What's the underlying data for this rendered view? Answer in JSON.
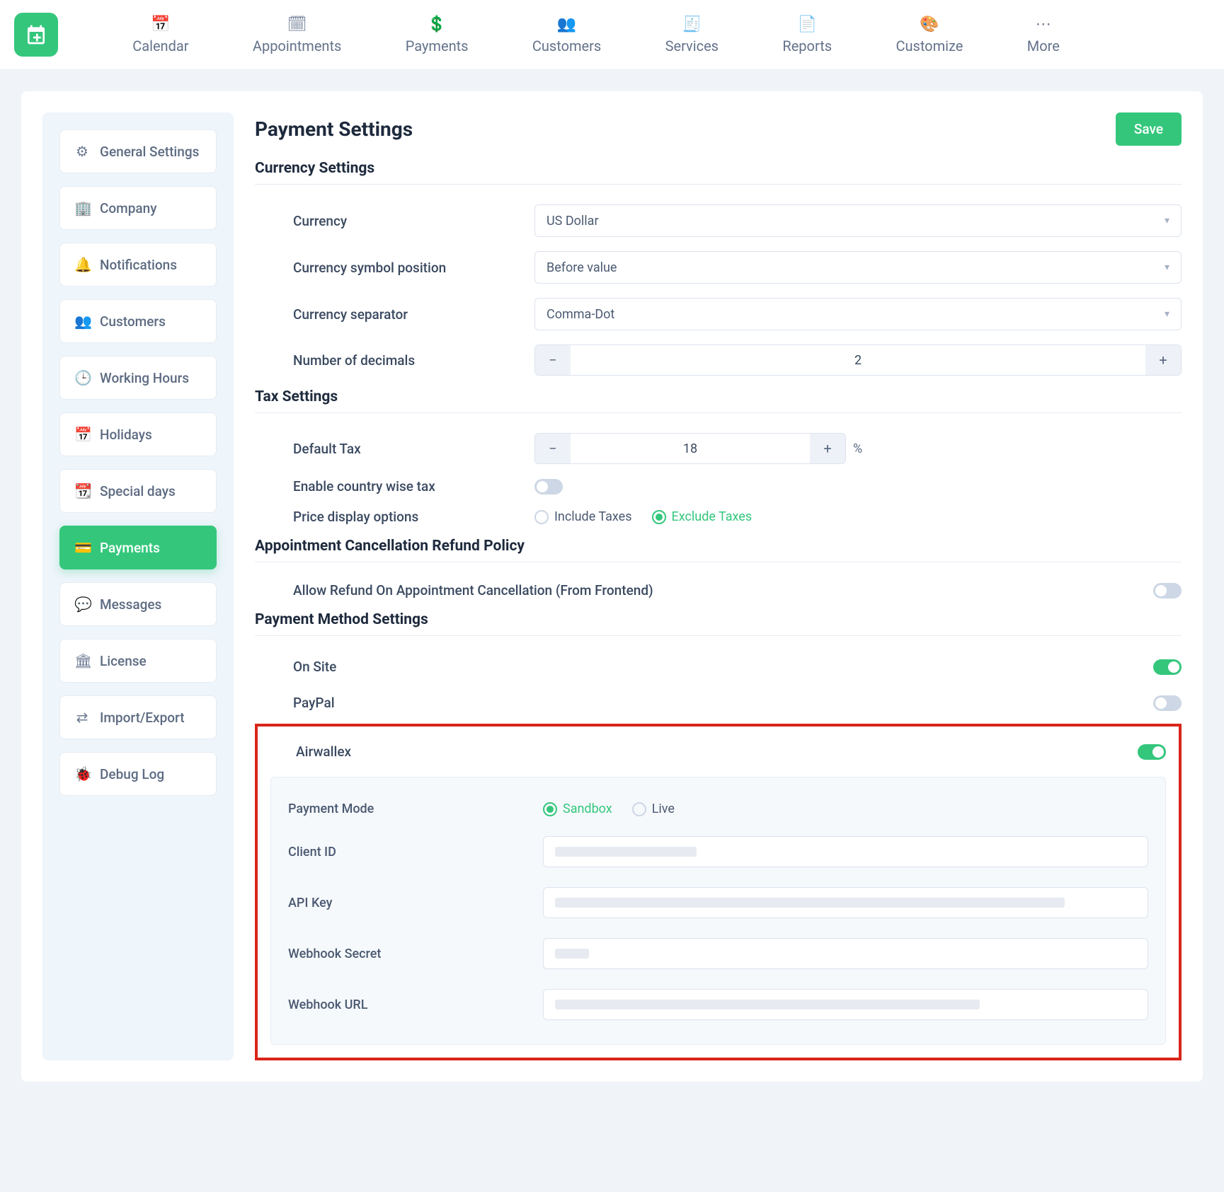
{
  "nav": {
    "items": [
      {
        "label": "Calendar"
      },
      {
        "label": "Appointments"
      },
      {
        "label": "Payments"
      },
      {
        "label": "Customers"
      },
      {
        "label": "Services"
      },
      {
        "label": "Reports"
      },
      {
        "label": "Customize"
      },
      {
        "label": "More"
      }
    ]
  },
  "sidebar": {
    "items": [
      {
        "label": "General Settings"
      },
      {
        "label": "Company"
      },
      {
        "label": "Notifications"
      },
      {
        "label": "Customers"
      },
      {
        "label": "Working Hours"
      },
      {
        "label": "Holidays"
      },
      {
        "label": "Special days"
      },
      {
        "label": "Payments"
      },
      {
        "label": "Messages"
      },
      {
        "label": "License"
      },
      {
        "label": "Import/Export"
      },
      {
        "label": "Debug Log"
      }
    ]
  },
  "page": {
    "title": "Payment Settings",
    "save": "Save"
  },
  "sections": {
    "currency": {
      "title": "Currency Settings",
      "currency_label": "Currency",
      "currency_value": "US Dollar",
      "position_label": "Currency symbol position",
      "position_value": "Before value",
      "separator_label": "Currency separator",
      "separator_value": "Comma-Dot",
      "decimals_label": "Number of decimals",
      "decimals_value": "2"
    },
    "tax": {
      "title": "Tax Settings",
      "default_label": "Default Tax",
      "default_value": "18",
      "suffix": "%",
      "countrywise_label": "Enable country wise tax",
      "display_label": "Price display options",
      "include": "Include Taxes",
      "exclude": "Exclude Taxes"
    },
    "refund": {
      "title": "Appointment Cancellation Refund Policy",
      "allow_label": "Allow Refund On Appointment Cancellation (From Frontend)"
    },
    "methods": {
      "title": "Payment Method Settings",
      "onsite": "On Site",
      "paypal": "PayPal",
      "airwallex": {
        "label": "Airwallex",
        "mode_label": "Payment Mode",
        "sandbox": "Sandbox",
        "live": "Live",
        "client_id": "Client ID",
        "api_key": "API Key",
        "webhook_secret": "Webhook Secret",
        "webhook_url": "Webhook URL"
      }
    }
  }
}
